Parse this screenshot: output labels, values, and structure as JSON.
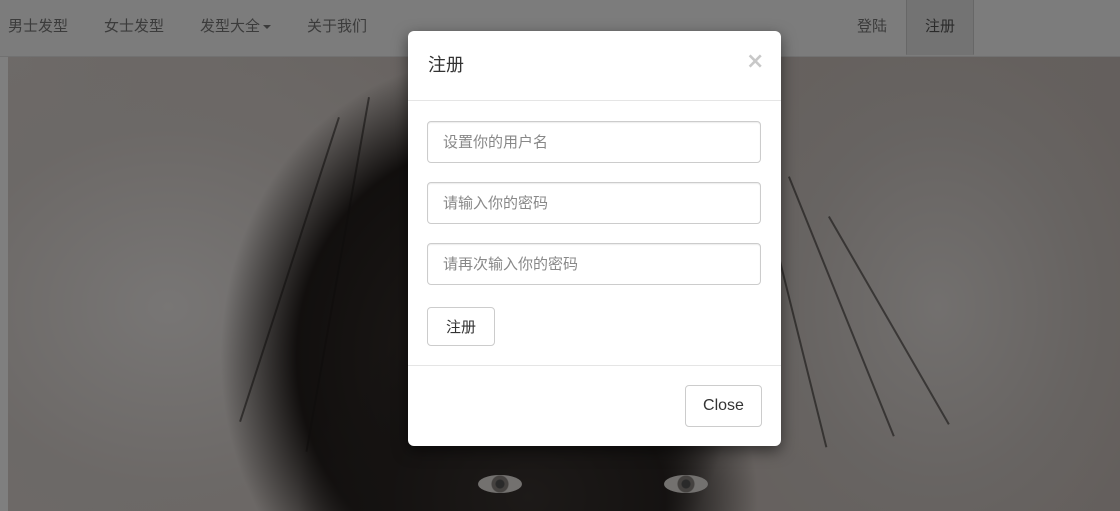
{
  "navbar": {
    "left_items": [
      {
        "label": "男士发型"
      },
      {
        "label": "女士发型"
      },
      {
        "label": "发型大全",
        "has_dropdown": true
      },
      {
        "label": "关于我们"
      }
    ],
    "login_label": "登陆",
    "register_label": "注册"
  },
  "modal": {
    "title": "注册",
    "close_icon": "×",
    "fields": {
      "username_placeholder": "设置你的用户名",
      "password_placeholder": "请输入你的密码",
      "confirm_password_placeholder": "请再次输入你的密码"
    },
    "submit_label": "注册",
    "close_label": "Close"
  }
}
